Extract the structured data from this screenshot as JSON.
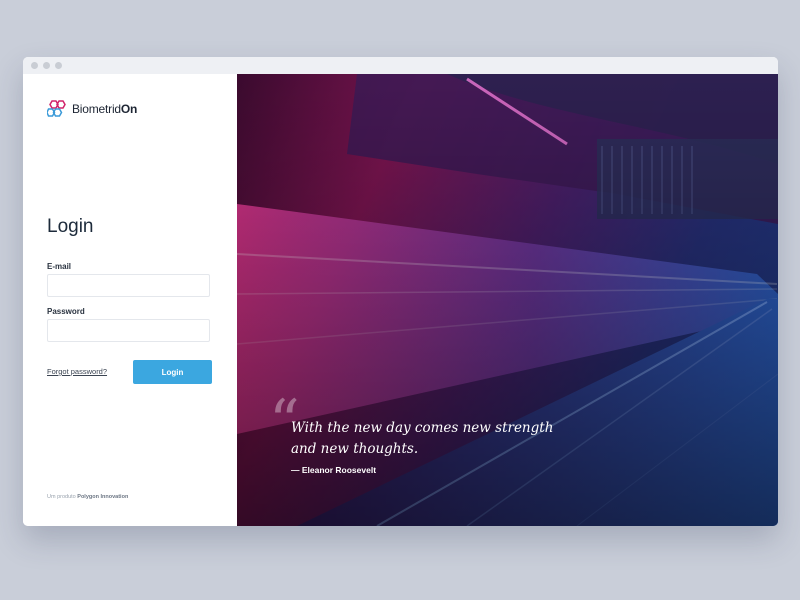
{
  "window": {
    "controls": [
      "close",
      "minimize",
      "maximize"
    ]
  },
  "brand": {
    "name_prefix": "Biometrid",
    "name_suffix": "On",
    "logo_icon": "hexagon-cluster-icon"
  },
  "login": {
    "title": "Login",
    "email_label": "E-mail",
    "email_value": "",
    "password_label": "Password",
    "password_value": "",
    "forgot_password": "Forgot password?",
    "submit": "Login"
  },
  "footer": {
    "prefix": "Um produto",
    "company": "Polygon Innovation"
  },
  "hero": {
    "quote_mark": "“",
    "quote_line1": "With the new day comes new strength",
    "quote_line2": "and new thoughts.",
    "author": "— Eleanor Roosevelt"
  },
  "colors": {
    "accent": "#3ba7e0",
    "background": "#c9ced9",
    "hero_pink": "#e0368f",
    "hero_blue": "#2f6bd6"
  }
}
